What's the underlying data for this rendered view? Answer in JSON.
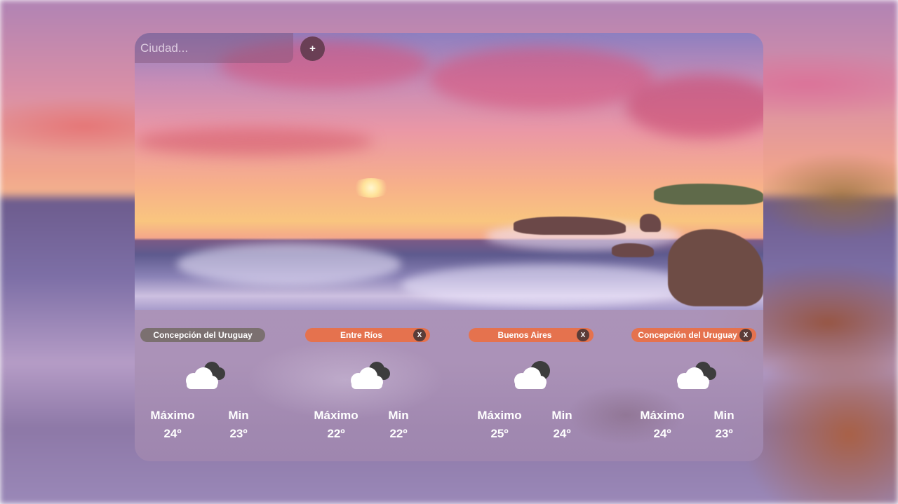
{
  "search": {
    "placeholder": "Ciudad..."
  },
  "add_button": {
    "label": "+"
  },
  "cities": [
    {
      "name": "Concepción del Uruguay",
      "selected": true,
      "close_label": "",
      "icon": "partly-cloudy-icon",
      "max_label": "Máximo",
      "max": "24º",
      "min_label": "Min",
      "min": "23º"
    },
    {
      "name": "Entre Ríos",
      "selected": false,
      "close_label": "X",
      "icon": "partly-cloudy-icon",
      "max_label": "Máximo",
      "max": "22º",
      "min_label": "Min",
      "min": "22º"
    },
    {
      "name": "Buenos Aires",
      "selected": false,
      "close_label": "X",
      "icon": "cloudy-night-icon",
      "max_label": "Máximo",
      "max": "25º",
      "min_label": "Min",
      "min": "24º"
    },
    {
      "name": "Concepción del Uruguay",
      "selected": false,
      "close_label": "X",
      "icon": "partly-cloudy-icon",
      "max_label": "Máximo",
      "max": "24º",
      "min_label": "Min",
      "min": "23º"
    }
  ],
  "colors": {
    "pill_selected": "#7b7070",
    "pill": "#e5724e",
    "add_button": "#6a3f55"
  }
}
